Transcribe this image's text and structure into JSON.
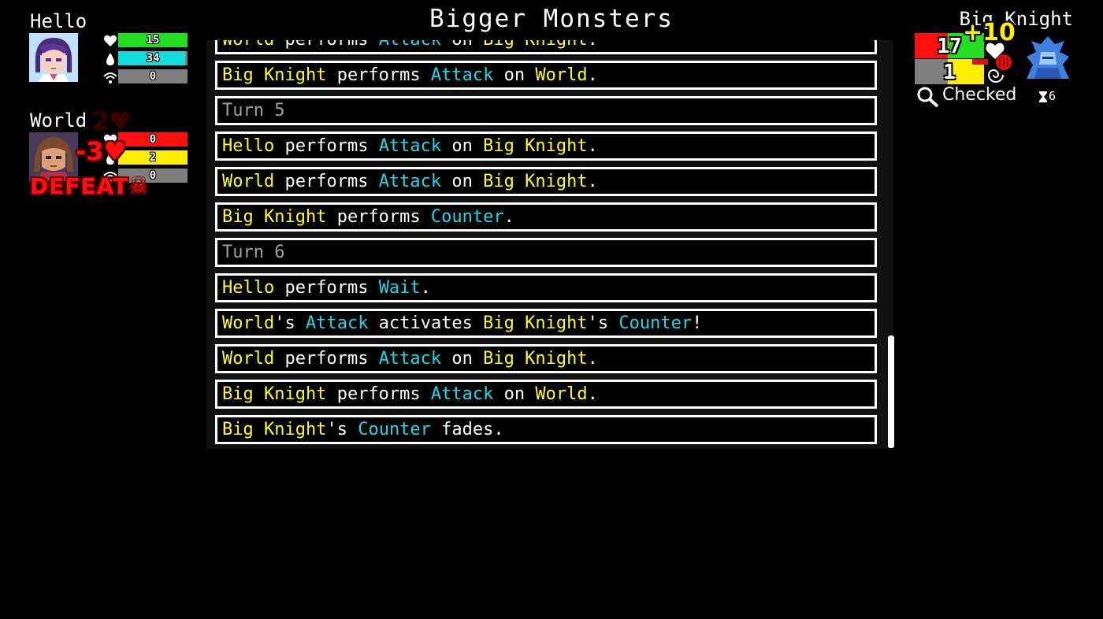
{
  "game_title": "Bigger Monsters",
  "party": [
    {
      "name": "Hello",
      "stats": [
        {
          "icon": "heart-icon",
          "value": "15",
          "fill": 1.0,
          "color": "#22dd22"
        },
        {
          "icon": "drop-icon",
          "value": "34",
          "fill": 0.97,
          "color": "#11dddd"
        },
        {
          "icon": "signal-icon",
          "value": "0",
          "fill": 0.0,
          "color": "#7f7f7f"
        }
      ]
    },
    {
      "name": "World",
      "stats": [
        {
          "icon": "heart-icon",
          "value": "0",
          "fill": 1.0,
          "color": "#ff1010"
        },
        {
          "icon": "drop-icon",
          "value": "2",
          "fill": 1.0,
          "color": "#ffee00"
        },
        {
          "icon": "signal-icon",
          "value": "0",
          "fill": 0.0,
          "color": "#7f7f7f"
        }
      ],
      "damage_popup": "-3",
      "faded_popup": "2",
      "status": "DEFEAT"
    }
  ],
  "enemy": {
    "name": "Big Knight",
    "hp": "17",
    "hp_color": "#ff1010",
    "hp_fill_color": "#22dd22",
    "secondary": "1",
    "secondary_color": "#ffee00",
    "heal_popup": "+10",
    "status": "Checked",
    "timer": "6"
  },
  "log": [
    [
      [
        "y",
        "World"
      ],
      [
        "w",
        " performs "
      ],
      [
        "c",
        "Attack"
      ],
      [
        "w",
        " on "
      ],
      [
        "y",
        "Big Knight"
      ],
      [
        "w",
        "."
      ]
    ],
    [
      [
        "y",
        "Big Knight"
      ],
      [
        "w",
        " performs "
      ],
      [
        "c",
        "Attack"
      ],
      [
        "w",
        " on "
      ],
      [
        "y",
        "World"
      ],
      [
        "w",
        "."
      ]
    ],
    [
      [
        "g",
        "Turn 5"
      ]
    ],
    [
      [
        "y",
        "Hello"
      ],
      [
        "w",
        " performs "
      ],
      [
        "c",
        "Attack"
      ],
      [
        "w",
        " on "
      ],
      [
        "y",
        "Big Knight"
      ],
      [
        "w",
        "."
      ]
    ],
    [
      [
        "y",
        "World"
      ],
      [
        "w",
        " performs "
      ],
      [
        "c",
        "Attack"
      ],
      [
        "w",
        " on "
      ],
      [
        "y",
        "Big Knight"
      ],
      [
        "w",
        "."
      ]
    ],
    [
      [
        "y",
        "Big Knight"
      ],
      [
        "w",
        " performs "
      ],
      [
        "c",
        "Counter"
      ],
      [
        "w",
        "."
      ]
    ],
    [
      [
        "g",
        "Turn 6"
      ]
    ],
    [
      [
        "y",
        "Hello"
      ],
      [
        "w",
        " performs "
      ],
      [
        "c",
        "Wait"
      ],
      [
        "w",
        "."
      ]
    ],
    [
      [
        "y",
        "World"
      ],
      [
        "w",
        "'s "
      ],
      [
        "c",
        "Attack"
      ],
      [
        "w",
        " activates "
      ],
      [
        "y",
        "Big Knight"
      ],
      [
        "w",
        "'s "
      ],
      [
        "c",
        "Counter"
      ],
      [
        "w",
        "!"
      ]
    ],
    [
      [
        "y",
        "World"
      ],
      [
        "w",
        " performs "
      ],
      [
        "c",
        "Attack"
      ],
      [
        "w",
        " on "
      ],
      [
        "y",
        "Big Knight"
      ],
      [
        "w",
        "."
      ]
    ],
    [
      [
        "y",
        "Big Knight"
      ],
      [
        "w",
        " performs "
      ],
      [
        "c",
        "Attack"
      ],
      [
        "w",
        " on "
      ],
      [
        "y",
        "World"
      ],
      [
        "w",
        "."
      ]
    ],
    [
      [
        "y",
        "Big Knight"
      ],
      [
        "w",
        "'s "
      ],
      [
        "c",
        "Counter"
      ],
      [
        "w",
        " fades."
      ]
    ]
  ]
}
